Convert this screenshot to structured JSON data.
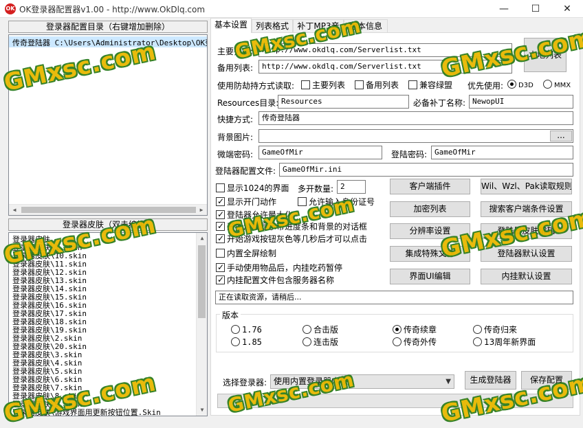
{
  "window": {
    "title": "OK登录器配置器v1.00 - http://www.OkDlq.com",
    "icon_text": "OK",
    "minimize": "—",
    "maximize": "☐",
    "close": "✕"
  },
  "left": {
    "config_dir_header": "登录器配置目录（右键增加删除）",
    "config_dir_item": "传奇登陆器 C:\\Users\\Administrator\\Desktop\\OK登陆器",
    "skin_header": "登录器皮肤（双击编辑）",
    "skins": [
      "登录器皮肤",
      "登录器皮肤\\1.skin",
      "登录器皮肤\\10.skin",
      "登录器皮肤\\11.skin",
      "登录器皮肤\\12.skin",
      "登录器皮肤\\13.skin",
      "登录器皮肤\\14.skin",
      "登录器皮肤\\15.skin",
      "登录器皮肤\\16.skin",
      "登录器皮肤\\17.skin",
      "登录器皮肤\\18.skin",
      "登录器皮肤\\19.skin",
      "登录器皮肤\\2.skin",
      "登录器皮肤\\20.skin",
      "登录器皮肤\\3.skin",
      "登录器皮肤\\4.skin",
      "登录器皮肤\\5.skin",
      "登录器皮肤\\6.skin",
      "登录器皮肤\\7.skin",
      "登录器皮肤\\8.skin",
      "登录器皮肤\\9.skin",
      "登录器皮肤\\游戏界面用更新按钮位置.Skin"
    ]
  },
  "tabs": [
    "基本设置",
    "列表格式",
    "补丁MP3音乐",
    "版本信息"
  ],
  "form": {
    "main_list_label": "主要列表:",
    "main_list_value": "http://www.okdlq.com/Serverlist.txt",
    "backup_list_label": "备用列表:",
    "backup_list_value": "http://www.okdlq.com/Serverlist.txt",
    "local_list_button": "本地列表",
    "anti_hijack_label": "使用防劫持方式读取:",
    "chk_main_list": "主要列表",
    "chk_backup_list": "备用列表",
    "chk_compat": "兼容绿盟",
    "priority_label": "优先使用:",
    "radio_d3d": "D3D",
    "radio_mmx": "MMX",
    "resources_label": "Resources目录:",
    "resources_value": "Resources",
    "patch_name_label": "必备补丁名称:",
    "patch_name_value": "NewopUI",
    "shortcut_label": "快捷方式:",
    "shortcut_value": "传奇登陆器",
    "bg_image_label": "背景图片:",
    "browse_button": "...",
    "micro_pwd_label": "微端密码:",
    "micro_pwd_value": "GameOfMir",
    "login_pwd_label": "登陆密码:",
    "login_pwd_value": "GameOfMir",
    "config_file_label": "登陆器配置文件:",
    "config_file_value": "GameOfMir.ini"
  },
  "options": {
    "show_1024": "显示1024的界面",
    "multi_count_label": "多开数量:",
    "multi_count_value": "2",
    "show_opening": "显示开门动作",
    "allow_id_input": "允许输入身份证号",
    "allow_maximize": "登陆器允许最大化",
    "start_game_dialog": "开始游戏显示带进度条和背景的对话框",
    "start_btn_grey": "开始游戏按钮灰色等几秒后才可以点击",
    "fullscreen_draw": "内置全屏绘制",
    "auto_use_items": "手动使用物品后，内挂吃药暂停",
    "config_include_server": "内挂配置文件包含服务器名称"
  },
  "buttons": {
    "client_plugin": "客户端插件",
    "wil_rules": "Wil、Wzl、Pak读取规则",
    "encrypt_list": "加密列表",
    "search_client": "搜索客户端条件设置",
    "resolution": "分辨率设置",
    "skin_edit": "登陆器皮肤编辑",
    "special_files": "集成特殊文件",
    "login_defaults": "登陆器默认设置",
    "ui_edit": "界面UI编辑",
    "plugin_defaults": "内挂默认设置",
    "generate": "生成登陆器",
    "save": "保存配置"
  },
  "status_text": "正在读取资源，请稍后...",
  "version": {
    "title": "版本",
    "options": [
      "1.76",
      "合击版",
      "传奇续章",
      "传奇归来",
      "1.85",
      "连击版",
      "传奇外传",
      "13周年新界面"
    ],
    "selected": "传奇续章"
  },
  "selector": {
    "label": "选择登录器:",
    "value": "使用内置登录器内核"
  },
  "progress": 0.0,
  "watermark": "GMxsc.com",
  "colors": {
    "accent": "#0078d7",
    "watermark_fill": "#e8b800",
    "watermark_outline": "#2e7d1e"
  }
}
